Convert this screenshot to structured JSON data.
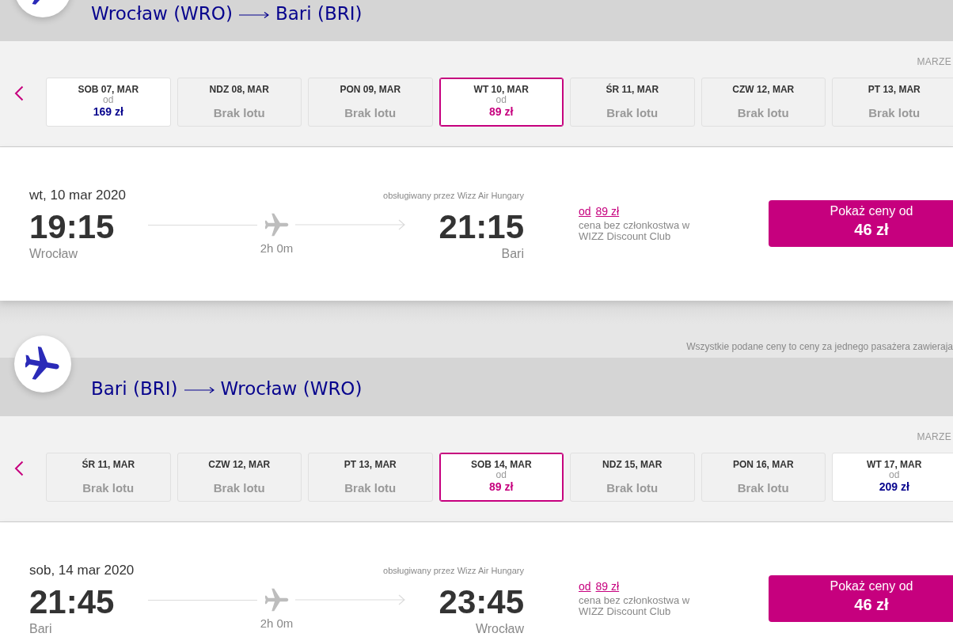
{
  "legs": [
    {
      "origin": "Wrocław (WRO)",
      "destination": "Bari (BRI)",
      "month": "MARZE",
      "dates": [
        {
          "day": "SOB 07, MAR",
          "kind": "available",
          "from": "od",
          "price": "169 zł",
          "selected": false
        },
        {
          "day": "NDZ 08, MAR",
          "kind": "none",
          "status": "Brak lotu",
          "selected": false
        },
        {
          "day": "PON 09, MAR",
          "kind": "none",
          "status": "Brak lotu",
          "selected": false
        },
        {
          "day": "WT 10, MAR",
          "kind": "available",
          "from": "od",
          "price": "89 zł",
          "selected": true
        },
        {
          "day": "ŚR 11, MAR",
          "kind": "none",
          "status": "Brak lotu",
          "selected": false
        },
        {
          "day": "CZW 12, MAR",
          "kind": "none",
          "status": "Brak lotu",
          "selected": false
        },
        {
          "day": "PT 13, MAR",
          "kind": "none",
          "status": "Brak lotu",
          "selected": false
        }
      ],
      "flight": {
        "date": "wt, 10 mar 2020",
        "operator": "obsługiwany przez Wizz Air Hungary",
        "departure_time": "19:15",
        "departure_city": "Wrocław",
        "duration": "2h 0m",
        "arrival_time": "21:15",
        "arrival_city": "Bari",
        "price_prefix": "od",
        "price": "89 zł",
        "price_note": "cena bez członkostwa w WIZZ Discount Club",
        "button_label": "Pokaż ceny od",
        "button_price": "46 zł"
      }
    },
    {
      "notice": "Wszystkie podane ceny to ceny za jednego pasażera zawieraja",
      "origin": "Bari (BRI)",
      "destination": "Wrocław (WRO)",
      "month": "MARZE",
      "dates": [
        {
          "day": "ŚR 11, MAR",
          "kind": "none",
          "status": "Brak lotu",
          "selected": false
        },
        {
          "day": "CZW 12, MAR",
          "kind": "none",
          "status": "Brak lotu",
          "selected": false
        },
        {
          "day": "PT 13, MAR",
          "kind": "none",
          "status": "Brak lotu",
          "selected": false
        },
        {
          "day": "SOB 14, MAR",
          "kind": "available",
          "from": "od",
          "price": "89 zł",
          "selected": true
        },
        {
          "day": "NDZ 15, MAR",
          "kind": "none",
          "status": "Brak lotu",
          "selected": false
        },
        {
          "day": "PON 16, MAR",
          "kind": "none",
          "status": "Brak lotu",
          "selected": false
        },
        {
          "day": "WT 17, MAR",
          "kind": "available",
          "from": "od",
          "price": "209 zł",
          "selected": false
        }
      ],
      "flight": {
        "date": "sob, 14 mar 2020",
        "operator": "obsługiwany przez Wizz Air Hungary",
        "departure_time": "21:45",
        "departure_city": "Bari",
        "duration": "2h 0m",
        "arrival_time": "23:45",
        "arrival_city": "Wrocław",
        "price_prefix": "od",
        "price": "89 zł",
        "price_note": "cena bez członkostwa w WIZZ Discount Club",
        "button_label": "Pokaż ceny od",
        "button_price": "46 zł"
      }
    }
  ]
}
